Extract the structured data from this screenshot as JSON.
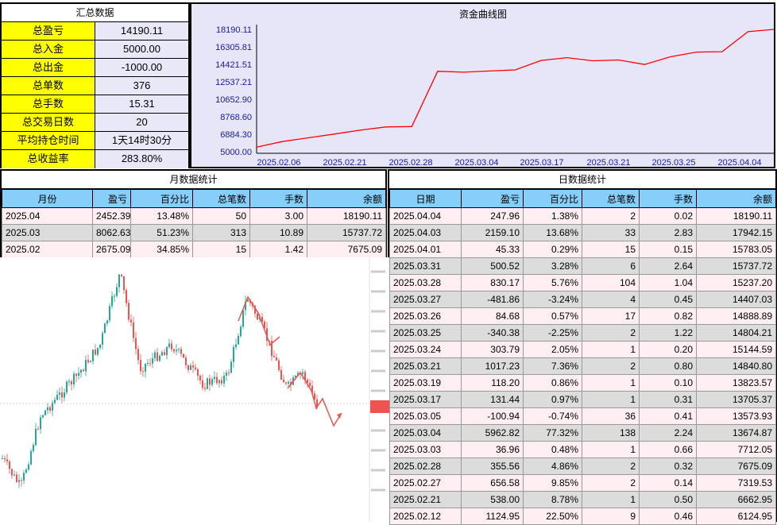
{
  "summary": {
    "title": "汇总数据",
    "rows": [
      {
        "label": "总盈亏",
        "value": "14190.11"
      },
      {
        "label": "总入金",
        "value": "5000.00"
      },
      {
        "label": "总出金",
        "value": "-1000.00"
      },
      {
        "label": "总单数",
        "value": "376"
      },
      {
        "label": "总手数",
        "value": "15.31"
      },
      {
        "label": "总交易日数",
        "value": "20"
      },
      {
        "label": "平均持仓时间",
        "value": "1天14时30分"
      },
      {
        "label": "总收益率",
        "value": "283.80%"
      }
    ]
  },
  "equity": {
    "title": "资金曲线图",
    "y_ticks": [
      "18190.11",
      "16305.81",
      "14421.51",
      "12537.21",
      "10652.90",
      "8768.60",
      "6884.30",
      "5000.00"
    ],
    "x_ticks": [
      "2025.02.06",
      "2025.02.21",
      "2025.02.28",
      "2025.03.04",
      "2025.03.17",
      "2025.03.21",
      "2025.03.25",
      "2025.04.04"
    ],
    "line_color": "#ff0000",
    "chart_data": {
      "type": "line",
      "ylim": [
        5000.0,
        18190.11
      ],
      "values": [
        5500,
        6100,
        6500,
        6900,
        7319.53,
        7675.09,
        7712.05,
        13674.87,
        13573.93,
        13705.37,
        13823.57,
        14840.8,
        15144.59,
        14804.21,
        14888.89,
        14407.03,
        15237.2,
        15737.72,
        15783.05,
        17942.15,
        18190.11
      ]
    }
  },
  "monthly": {
    "title": "月数据统计",
    "headers": [
      "月份",
      "盈亏",
      "百分比",
      "总笔数",
      "手数",
      "余额"
    ],
    "rows": [
      [
        "2025.04",
        "2452.39",
        "13.48%",
        "50",
        "3.00",
        "18190.11"
      ],
      [
        "2025.03",
        "8062.63",
        "51.23%",
        "313",
        "10.89",
        "15737.72"
      ],
      [
        "2025.02",
        "2675.09",
        "34.85%",
        "15",
        "1.42",
        "7675.09"
      ]
    ]
  },
  "daily": {
    "title": "日数据统计",
    "headers": [
      "日期",
      "盈亏",
      "百分比",
      "总笔数",
      "手数",
      "余额"
    ],
    "rows": [
      [
        "2025.04.04",
        "247.96",
        "1.38%",
        "2",
        "0.02",
        "18190.11"
      ],
      [
        "2025.04.03",
        "2159.10",
        "13.68%",
        "33",
        "2.83",
        "17942.15"
      ],
      [
        "2025.04.01",
        "45.33",
        "0.29%",
        "15",
        "0.15",
        "15783.05"
      ],
      [
        "2025.03.31",
        "500.52",
        "3.28%",
        "6",
        "2.64",
        "15737.72"
      ],
      [
        "2025.03.28",
        "830.17",
        "5.76%",
        "104",
        "1.04",
        "15237.20"
      ],
      [
        "2025.03.27",
        "-481.86",
        "-3.24%",
        "4",
        "0.45",
        "14407.03"
      ],
      [
        "2025.03.26",
        "84.68",
        "0.57%",
        "17",
        "0.82",
        "14888.89"
      ],
      [
        "2025.03.25",
        "-340.38",
        "-2.25%",
        "2",
        "1.22",
        "14804.21"
      ],
      [
        "2025.03.24",
        "303.79",
        "2.05%",
        "1",
        "0.20",
        "15144.59"
      ],
      [
        "2025.03.21",
        "1017.23",
        "7.36%",
        "2",
        "0.80",
        "14840.80"
      ],
      [
        "2025.03.19",
        "118.20",
        "0.86%",
        "1",
        "0.10",
        "13823.57"
      ],
      [
        "2025.03.17",
        "131.44",
        "0.97%",
        "1",
        "0.31",
        "13705.37"
      ],
      [
        "2025.03.05",
        "-100.94",
        "-0.74%",
        "36",
        "0.41",
        "13573.93"
      ],
      [
        "2025.03.04",
        "5962.82",
        "77.32%",
        "138",
        "2.24",
        "13674.87"
      ],
      [
        "2025.03.03",
        "36.96",
        "0.48%",
        "1",
        "0.66",
        "7712.05"
      ],
      [
        "2025.02.28",
        "355.56",
        "4.86%",
        "2",
        "0.32",
        "7675.09"
      ],
      [
        "2025.02.27",
        "656.58",
        "9.85%",
        "2",
        "0.14",
        "7319.53"
      ],
      [
        "2025.02.21",
        "538.00",
        "8.78%",
        "1",
        "0.50",
        "6662.95"
      ],
      [
        "2025.02.12",
        "1124.95",
        "22.50%",
        "9",
        "0.46",
        "6124.95"
      ]
    ]
  },
  "overlay": {
    "up_color": "#26a69a",
    "down_color": "#ef5350",
    "price_tag": "3166.66"
  }
}
